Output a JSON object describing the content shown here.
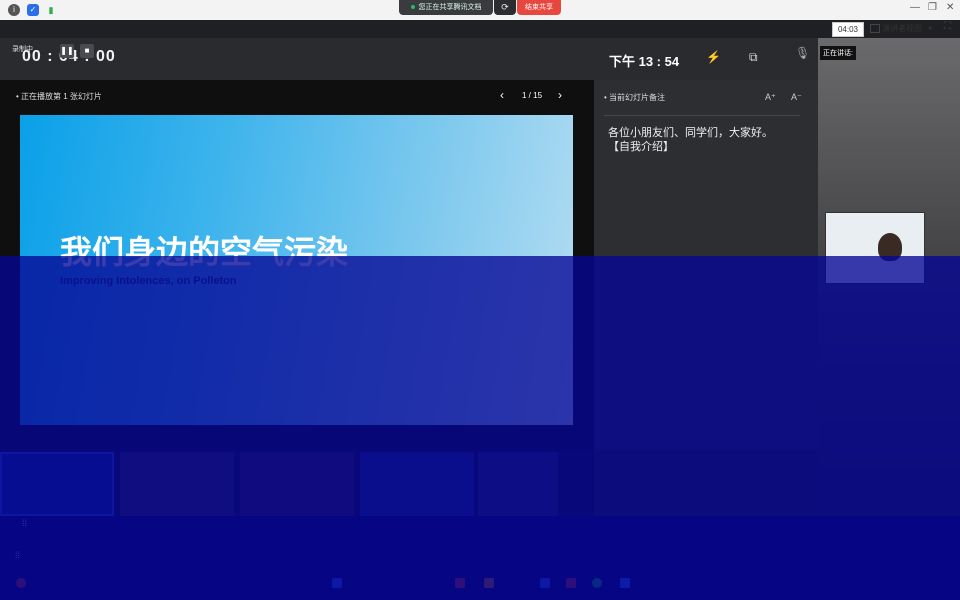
{
  "share_bar": {
    "status": "您正在共享腾讯文档",
    "end": "结束共享"
  },
  "window": {
    "elapsed_clock": "04:03",
    "view_mode": "演讲者视图",
    "view_mode_caret": "▾",
    "minimize": "—",
    "restore": "❐",
    "close": "✕"
  },
  "presenter": {
    "recording_label": "录制中",
    "timer": "00 : 04 : 00",
    "clock": "下午 13 : 54",
    "now_playing": "正在播放第 1 张幻灯片",
    "page": "1 / 15",
    "notes_title": "当前幻灯片备注",
    "font_up": "A⁺",
    "font_down": "A⁻",
    "notes": "各位小朋友们、同学们，大家好。\n【自我介绍】"
  },
  "slide": {
    "title": "我们身边的空气污染",
    "subtitle": "Improving Intolences, on Polleton"
  },
  "speaker": {
    "label": "正在讲话:"
  },
  "icons": {
    "pause": "❚❚",
    "stop": "■",
    "prev": "‹",
    "next": "›",
    "laser": "⚡",
    "screen": "⧉",
    "mic": "🎙",
    "grid": "⁞⁞",
    "fullscreen": "⛶",
    "refresh": "⟳"
  },
  "colors": {
    "end_share": "#e8473f",
    "slide_blue": "#0aa0e8",
    "overlay": "#0505a0"
  }
}
